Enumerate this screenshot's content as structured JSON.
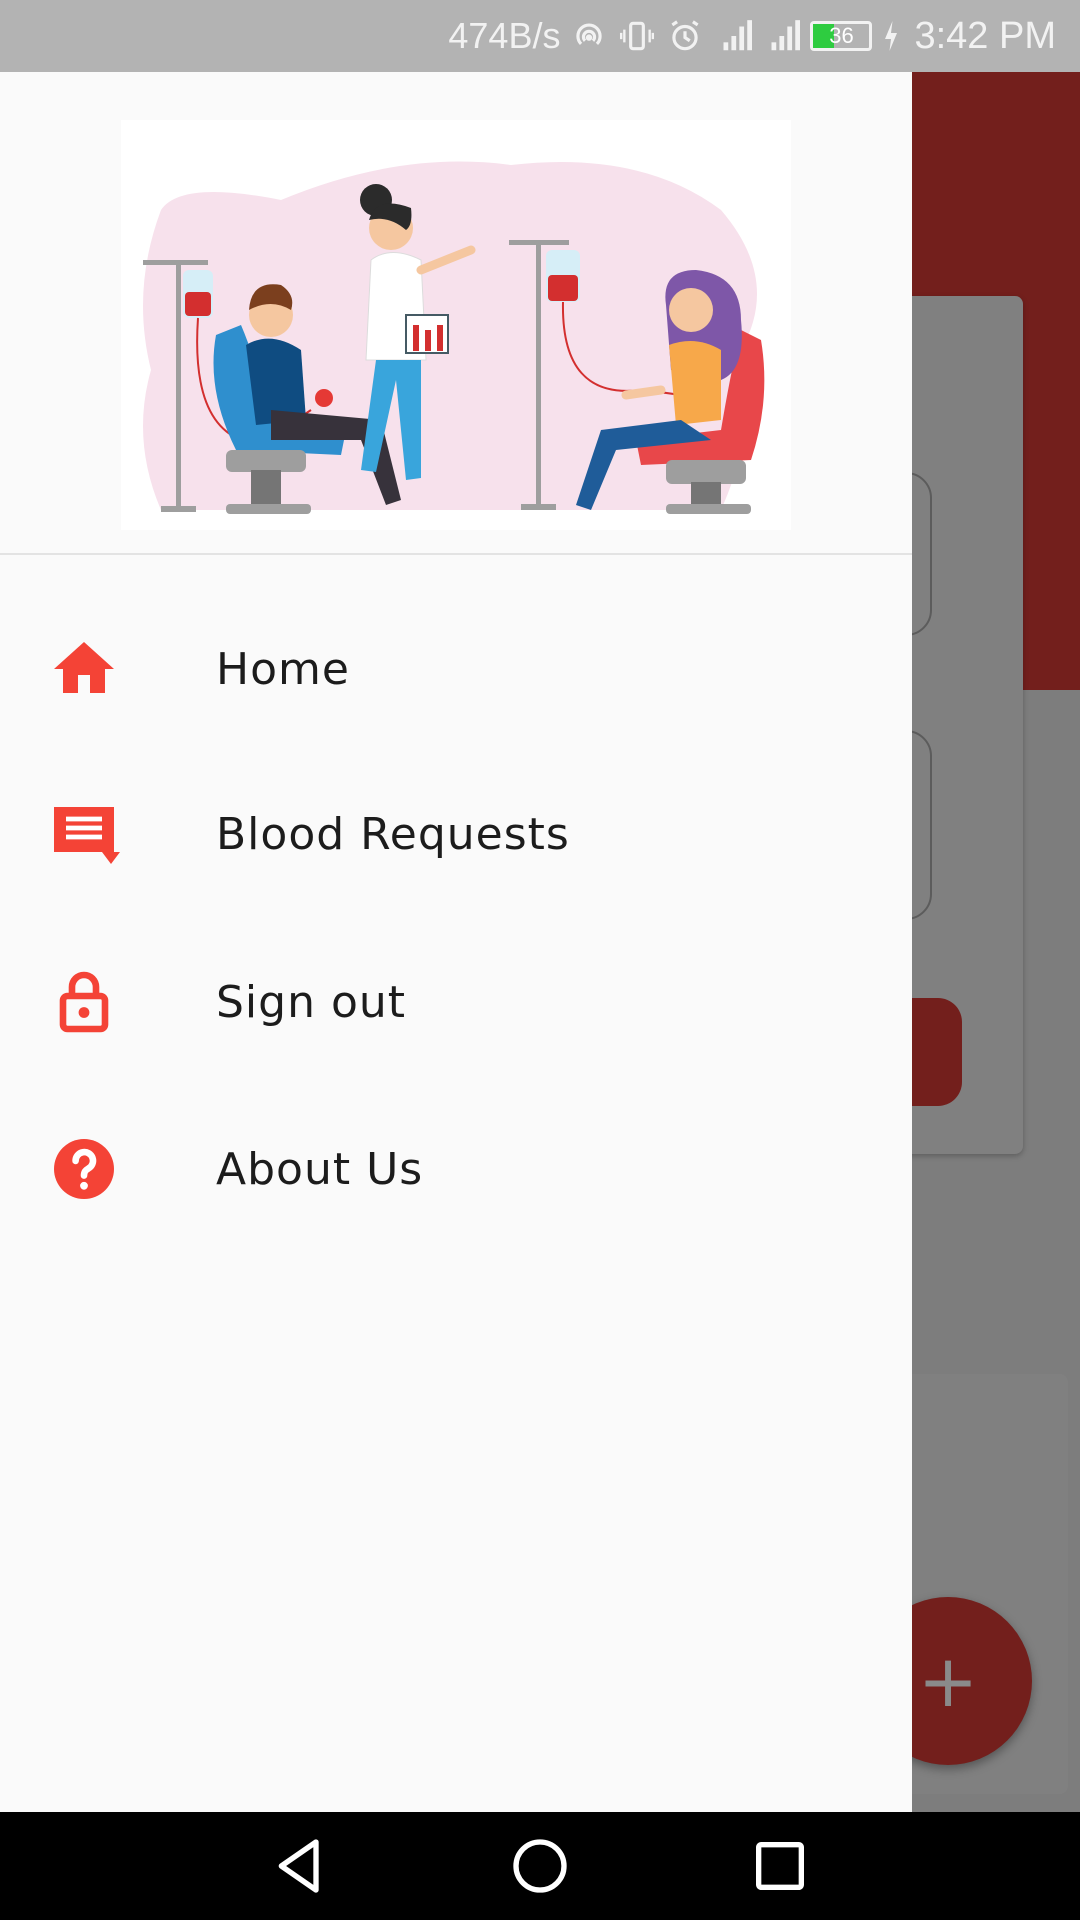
{
  "status_bar": {
    "network_speed": "474B/s",
    "battery_level": "36",
    "battery_fraction": 0.36,
    "time": "3:42 PM",
    "icons": [
      "hotspot-icon",
      "vibrate-icon",
      "alarm-icon",
      "signal-4g-icon",
      "signal-2g-icon",
      "battery-icon",
      "charging-icon"
    ]
  },
  "drawer": {
    "header_image": "blood-donation-illustration",
    "items": [
      {
        "label": "Home",
        "icon": "home-icon"
      },
      {
        "label": "Blood Requests",
        "icon": "message-icon"
      },
      {
        "label": "Sign out",
        "icon": "lock-icon"
      },
      {
        "label": "About Us",
        "icon": "help-circle-icon"
      }
    ]
  },
  "background_app": {
    "fab_symbol": "+"
  },
  "colors": {
    "accent": "#f44336",
    "app_primary_dimmed": "#731f1c",
    "drawer_bg": "#fafafa",
    "status_bar_bg": "#b3b3b3"
  },
  "nav_bar": {
    "buttons": [
      "back-icon",
      "home-circle-icon",
      "recents-icon"
    ]
  }
}
